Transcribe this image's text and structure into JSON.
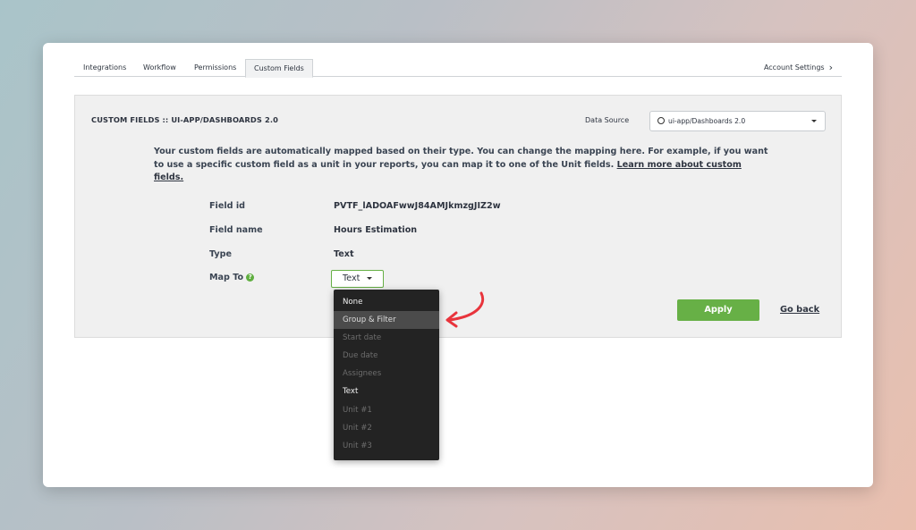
{
  "tabs": [
    {
      "label": "Integrations"
    },
    {
      "label": "Workflow"
    },
    {
      "label": "Permissions"
    },
    {
      "label": "Custom Fields",
      "active": true
    }
  ],
  "account_settings": {
    "label": "Account Settings",
    "icon": "chevron-right-icon"
  },
  "panel": {
    "title": "CUSTOM FIELDS :: UI-APP/DASHBOARDS 2.0",
    "data_source_label": "Data Source",
    "data_source_value": "ui-app/Dashboards 2.0",
    "data_source_icon": "github-icon",
    "description": "Your custom fields are automatically mapped based on their type. You can change the mapping here. For example, if you want to use a specific custom field as a unit in your reports, you can map it to one of the Unit fields. ",
    "learn_more_link": "Learn more about custom fields.",
    "fields": {
      "field_id_label": "Field id",
      "field_id_value": "PVTF_lADOAFwwJ84AMJkmzgJIZ2w",
      "field_name_label": "Field name",
      "field_name_value": "Hours Estimation",
      "type_label": "Type",
      "type_value": "Text",
      "map_to_label": "Map To",
      "map_to_value": "Text",
      "help_icon": "question-circle-icon"
    },
    "apply_label": "Apply",
    "go_back_label": "Go back"
  },
  "dropdown": {
    "options": [
      {
        "label": "None",
        "state": "enabled"
      },
      {
        "label": "Group & Filter",
        "state": "hover"
      },
      {
        "label": "Start date",
        "state": "disabled"
      },
      {
        "label": "Due date",
        "state": "disabled"
      },
      {
        "label": "Assignees",
        "state": "disabled"
      },
      {
        "label": "Text",
        "state": "enabled"
      },
      {
        "label": "Unit #1",
        "state": "disabled"
      },
      {
        "label": "Unit #2",
        "state": "disabled"
      },
      {
        "label": "Unit #3",
        "state": "disabled"
      }
    ]
  },
  "colors": {
    "accent": "#67b046",
    "annotation_arrow": "#e8343c",
    "dropdown_bg": "#232323"
  }
}
